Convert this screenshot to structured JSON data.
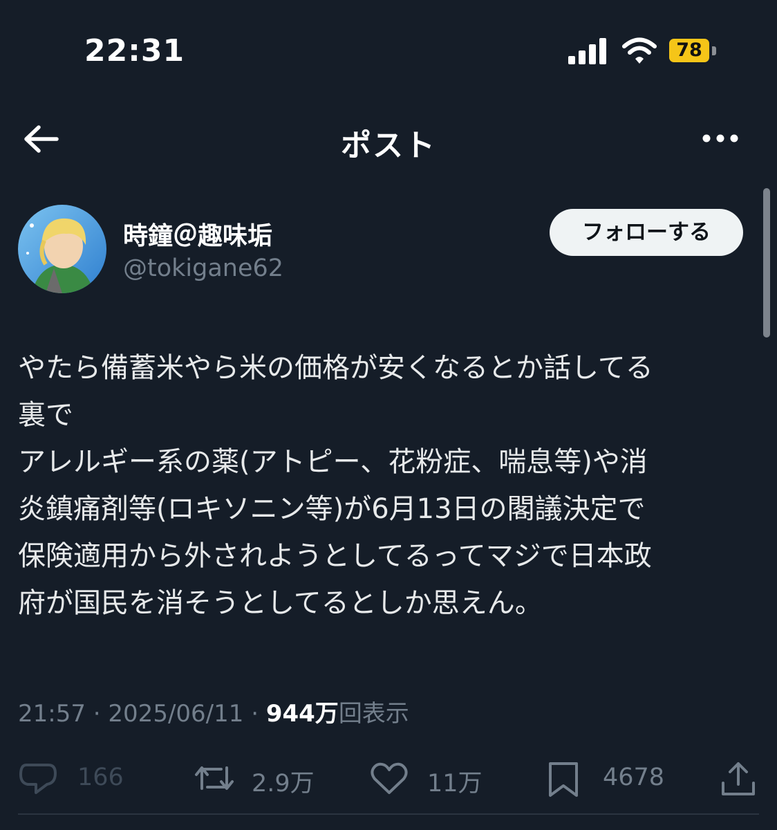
{
  "status_bar": {
    "time": "22:31",
    "battery_level": "78",
    "battery_color": "#f5c518",
    "icons": [
      "signal-icon",
      "wifi-icon",
      "battery-icon"
    ]
  },
  "header": {
    "title": "ポスト",
    "back_icon": "back-arrow-icon",
    "more_icon": "more-dots-icon"
  },
  "author": {
    "display_name": "時鐘＠趣味垢",
    "handle": "@tokigane62",
    "follow_label": "フォローする"
  },
  "post": {
    "lines": [
      "やたら備蓄米やら米の価格が安くなるとか話してる",
      "裏で",
      "アレルギー系の薬(アトピー、花粉症、喘息等)や消",
      "炎鎮痛剤等(ロキソニン等)が6月13日の閣議決定で",
      "保険適用から外されようとしてるってマジで日本政",
      "府が国民を消そうとしてるとしか思えん。"
    ]
  },
  "meta": {
    "time": "21:57",
    "separator": " · ",
    "date": "2025/06/11",
    "views_count": "944万",
    "views_label": "回表示"
  },
  "actions": {
    "reply_count": "166",
    "repost_count": "2.9万",
    "like_count": "11万",
    "bookmark_count": "4678"
  },
  "colors": {
    "background": "#151d28",
    "text": "#e7e9ea",
    "muted": "#737f8c",
    "follow_button": "#eff3f4"
  }
}
